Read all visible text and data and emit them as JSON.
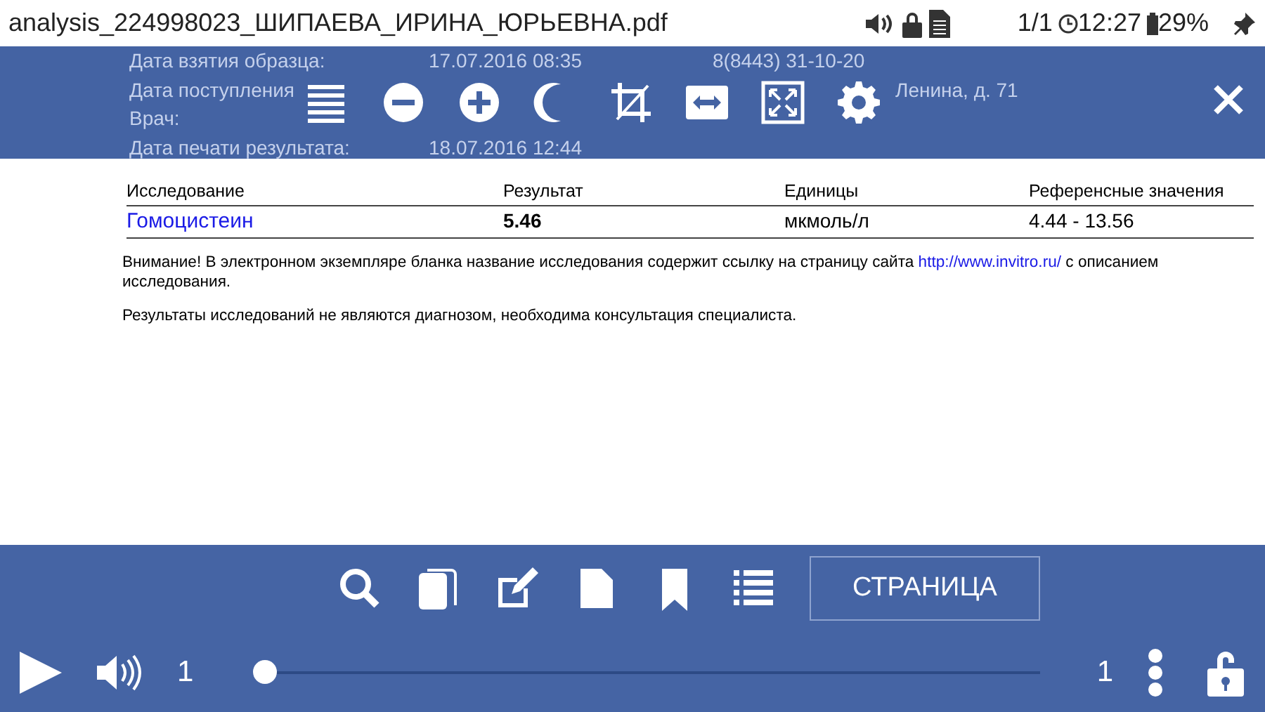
{
  "status_bar": {
    "title": "analysis_224998023_ШИПАЕВА_ИРИНА_ЮРЬЕВНА.pdf",
    "pages": "1/1",
    "time": "12:27",
    "battery": "29%"
  },
  "document_header": [
    {
      "label": "Дата взятия образца:",
      "value": "17.07.2016 08:35",
      "extra": "8(8443) 31-10-20"
    },
    {
      "label": "Дата поступления",
      "extra": "Ленина, д. 71"
    },
    {
      "label": "Врач:"
    },
    {
      "label": "Дата печати результата:",
      "value": "18.07.2016 12:44"
    }
  ],
  "table": {
    "columns": [
      "Исследование",
      "Результат",
      "Единицы",
      "Референсные значения"
    ],
    "rows": [
      {
        "test": "Гомоцистеин",
        "result": "5.46",
        "units": "мкмоль/л",
        "reference": "4.44 - 13.56"
      }
    ]
  },
  "notes": [
    {
      "text": "Внимание! В электронном экземпляре бланка название исследования содержит ссылку на страницу сайта",
      "link": "http://www.invitro.ru/",
      "after": "с описанием исследования."
    },
    {
      "text": "Результаты исследований не являются диагнозом, необходима консультация специалиста."
    }
  ],
  "bottom_bar": {
    "page_button": "СТРАНИЦА",
    "current_page": "1",
    "total_pages": "1",
    "level": 0
  }
}
